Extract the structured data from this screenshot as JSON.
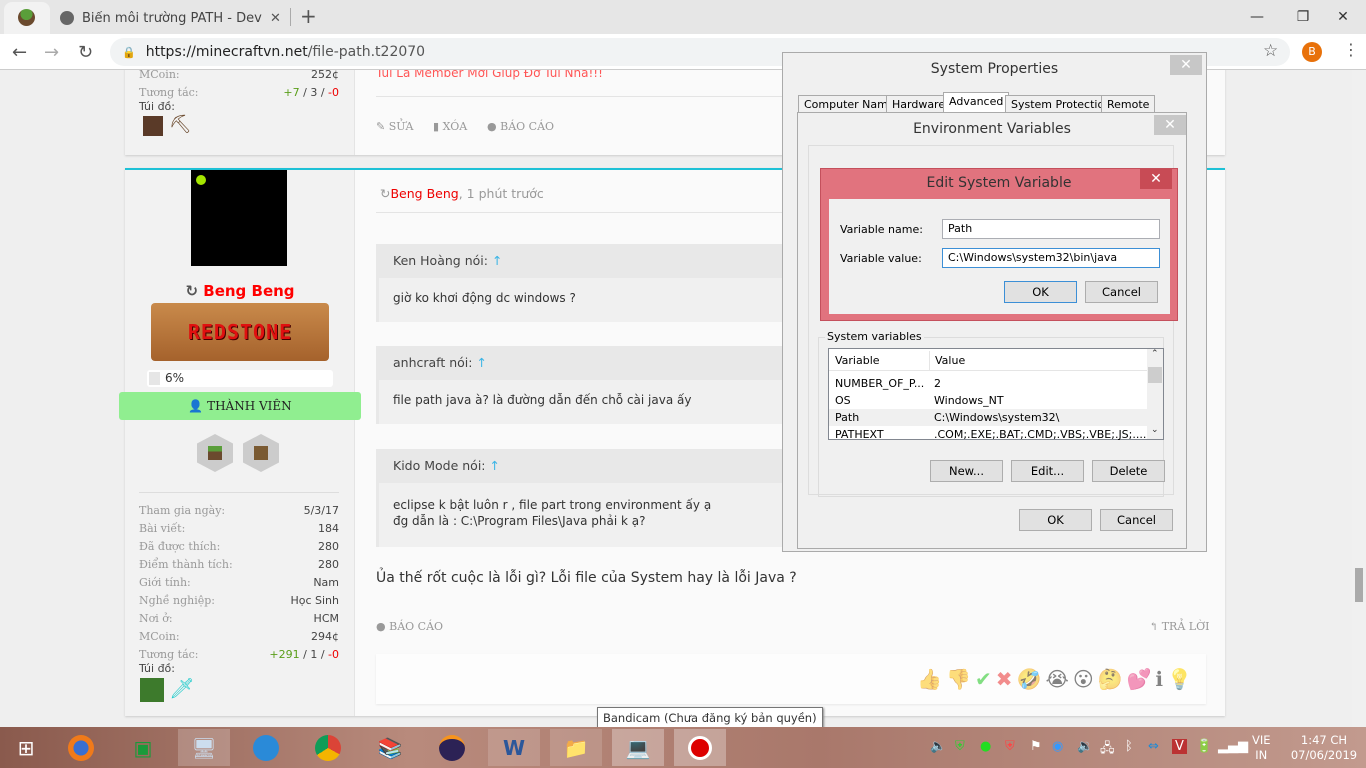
{
  "browser": {
    "tab_title": "Biến môi trường PATH - DevNT.c",
    "url_host": "https://minecraftvn.net",
    "url_path": "/file-path.t22070",
    "avatar_letter": "B"
  },
  "post1": {
    "stats": [
      {
        "label": "MCoin:",
        "value": "252¢"
      }
    ],
    "interact_label": "Tương tác:",
    "interact_pos": "+7",
    "interact_mid": " / 3 / ",
    "interact_neg": "-0",
    "bag_label": "Túi đồ:",
    "signature": "Tui Là Member Mới Giúp Đỡ Tui Nha!!!",
    "actions": [
      "SỬA",
      "XÓA",
      "BÁO CÁO"
    ]
  },
  "post2": {
    "author": "Beng Beng",
    "time": ", 1 phút trước",
    "rank_banner": "REDSTONE",
    "progress_label": "6%",
    "progress": 6,
    "role": "THÀNH VIÊN",
    "stats": [
      {
        "label": "Tham gia ngày:",
        "value": "5/3/17"
      },
      {
        "label": "Bài viết:",
        "value": "184"
      },
      {
        "label": "Đã được thích:",
        "value": "280"
      },
      {
        "label": "Điểm thành tích:",
        "value": "280"
      },
      {
        "label": "Giới tính:",
        "value": "Nam"
      },
      {
        "label": "Nghề nghiệp:",
        "value": "Học Sinh"
      },
      {
        "label": "Nơi ở:",
        "value": "HCM"
      },
      {
        "label": "MCoin:",
        "value": "294¢"
      }
    ],
    "interact_label": "Tương tác:",
    "interact_pos": "+291",
    "interact_mid": " / 1 / ",
    "interact_neg": "-0",
    "bag_label": "Túi đồ:",
    "quotes": [
      {
        "author": "Ken Hoàng nói:",
        "body": "giờ ko khơi động dc windows ?"
      },
      {
        "author": "anhcraft nói:",
        "body": "file path java à? là đường dẫn đến chỗ cài java ấy"
      },
      {
        "author": "Kido Mode nói:",
        "body": "eclipse k bật luôn r , file part trong environment ấy ạ\nđg dẫn là : C:\\Program Files\\Java phải k ạ?"
      }
    ],
    "message": "Ủa thế rốt cuộc là lỗi gì? Lỗi file của System hay là lỗi Java ?",
    "report": "BÁO CÁO",
    "reply": "TRẢ LỜI",
    "arrow": "↑"
  },
  "sysprops": {
    "title": "System Properties",
    "tabs": [
      "Computer Name",
      "Hardware",
      "Advanced",
      "System Protection",
      "Remote"
    ]
  },
  "envvars": {
    "title": "Environment Variables",
    "group": "System variables",
    "col_variable": "Variable",
    "col_value": "Value",
    "rows": [
      {
        "name": "NUMBER_OF_P...",
        "value": "2"
      },
      {
        "name": "OS",
        "value": "Windows_NT"
      },
      {
        "name": "Path",
        "value": "C:\\Windows\\system32\\"
      },
      {
        "name": "PATHEXT",
        "value": ".COM;.EXE;.BAT;.CMD;.VBS;.VBE;.JS;...."
      }
    ],
    "new": "New...",
    "edit": "Edit...",
    "delete": "Delete",
    "ok": "OK",
    "cancel": "Cancel"
  },
  "editvar": {
    "title": "Edit System Variable",
    "name_label": "Variable name:",
    "name_value": "Path",
    "value_label": "Variable value:",
    "value_value": "C:\\Windows\\system32\\bin\\java",
    "ok": "OK",
    "cancel": "Cancel"
  },
  "tooltip": "Bandicam (Chưa đăng ký bản quyền)",
  "clock": {
    "lang1": "VIE",
    "lang2": "IN",
    "time": "1:47 CH",
    "date": "07/06/2019"
  }
}
